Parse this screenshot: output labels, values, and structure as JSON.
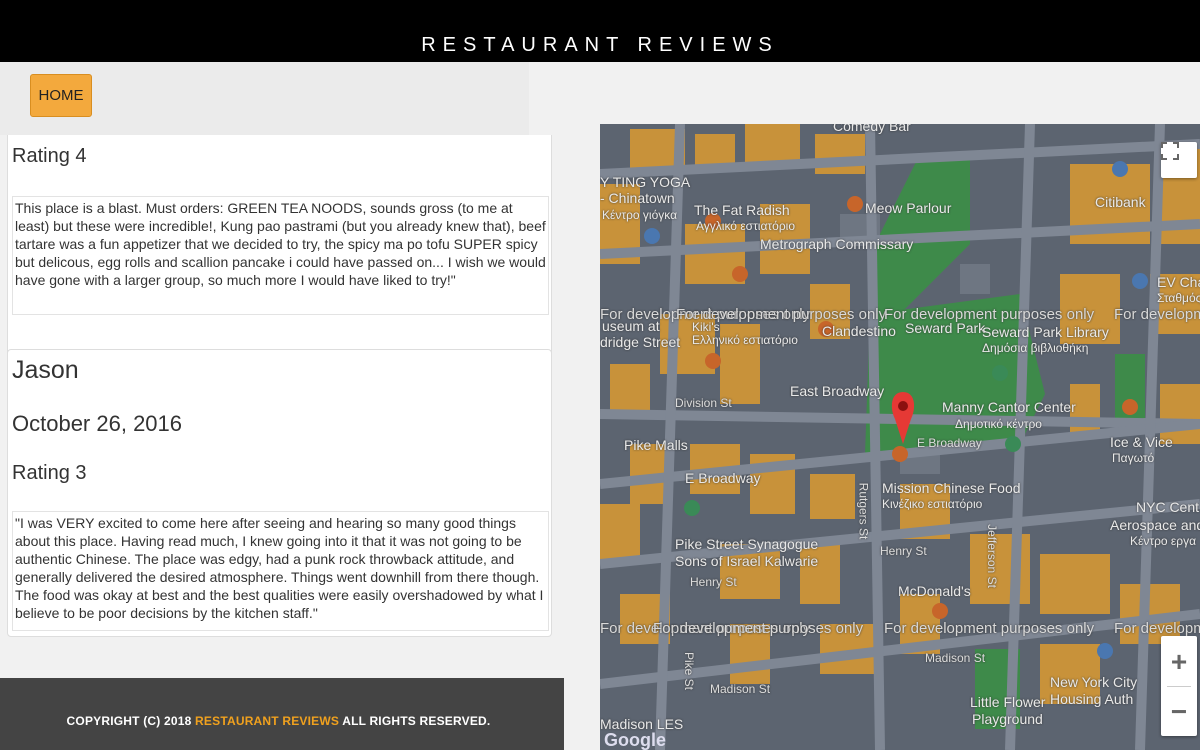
{
  "header": {
    "title": "RESTAURANT REVIEWS"
  },
  "nav": {
    "home_label": "HOME"
  },
  "reviews": [
    {
      "rating": "Rating 4",
      "text": "This place is a blast. Must orders: GREEN TEA NOODS, sounds gross (to me at least) but these were incredible!, Kung pao pastrami (but you already knew that), beef tartare was a fun appetizer that we decided to try, the spicy ma po tofu SUPER spicy but delicous, egg rolls and scallion pancake i could have passed on... I wish we would have gone with a larger group, so much more I would have liked to try!\""
    },
    {
      "name": "Jason",
      "date": "October 26, 2016",
      "rating": "Rating 3",
      "text": "\"I was VERY excited to come here after seeing and hearing so many good things about this place. Having read much, I knew going into it that it was not going to be authentic Chinese. The place was edgy, had a punk rock throwback attitude, and generally delivered the desired atmosphere. Things went downhill from there though. The food was okay at best and the best qualities were easily overshadowed by what I believe to be poor decisions by the kitchen staff.\""
    }
  ],
  "footer": {
    "prefix": "COPYRIGHT (C) 2018 ",
    "brand": "RESTAURANT REVIEWS",
    "suffix": " ALL RIGHTS RESERVED."
  },
  "map": {
    "dev_watermark": "For development purposes only",
    "labels": {
      "ting_yoga": "Y TING YOGA",
      "chinatown": "- Chinatown",
      "kentro": "Κέντρο γιόγκα",
      "fat_radish": "The Fat Radish",
      "fat_radish_gr": "Αγγλικό εστιατόριο",
      "meow": "Meow Parlour",
      "metrograph": "Metrograph Commissary",
      "citibank": "Citibank",
      "ev": "EV Chargi",
      "ev_gr": "Σταθμός φόρτ",
      "museum": "useum at",
      "bridge": "dridge Street",
      "kikis": "Kiki's",
      "kikis_gr": "Ελληνικό εστιατόριο",
      "clandestino": "Clandestino",
      "seward_park": "Seward Park",
      "seward_lib": "Seward Park Library",
      "seward_lib_gr": "Δημόσια βιβλιοθήκη",
      "east_broadway": "East Broadway",
      "manny": "Manny Cantor Center",
      "manny_gr": "Δημοτικό κέντρο",
      "division": "Division St",
      "pike_malls": "Pike Malls",
      "e_broadway": "E Broadway",
      "e_broadway2": "E Broadway",
      "ice": "Ice & Vice",
      "ice_gr": "Παγωτό",
      "mission": "Mission Chinese Food",
      "mission_gr": "Κινέζικο εστιατόριο",
      "rutgers": "Rutgers St",
      "jefferson": "Jefferson St",
      "nyc": "NYC Cent",
      "aero": "Aerospace and Ap",
      "aero_gr": "Κέντρο εργα",
      "pike_syn": "Pike Street Synagogue",
      "sons": "Sons of Israel Kalwarie",
      "henry": "Henry St",
      "henry2": "Henry St",
      "mcd": "McDonald's",
      "madison": "Madison St",
      "madison2": "Madison St",
      "pike_st": "Pike St",
      "lfp": "Little Flower",
      "lfp2": "Playground",
      "nych": "New York City",
      "nych2": "Housing Auth",
      "madison_les": "Madison LES",
      "comedy": "Comedy Bar",
      "google": "Google"
    }
  },
  "colors": {
    "accent": "#f3a93d",
    "header_bg": "#000000",
    "footer_bg": "#444444",
    "footer_brand": "#f0a11e",
    "marker": "#e53935"
  }
}
